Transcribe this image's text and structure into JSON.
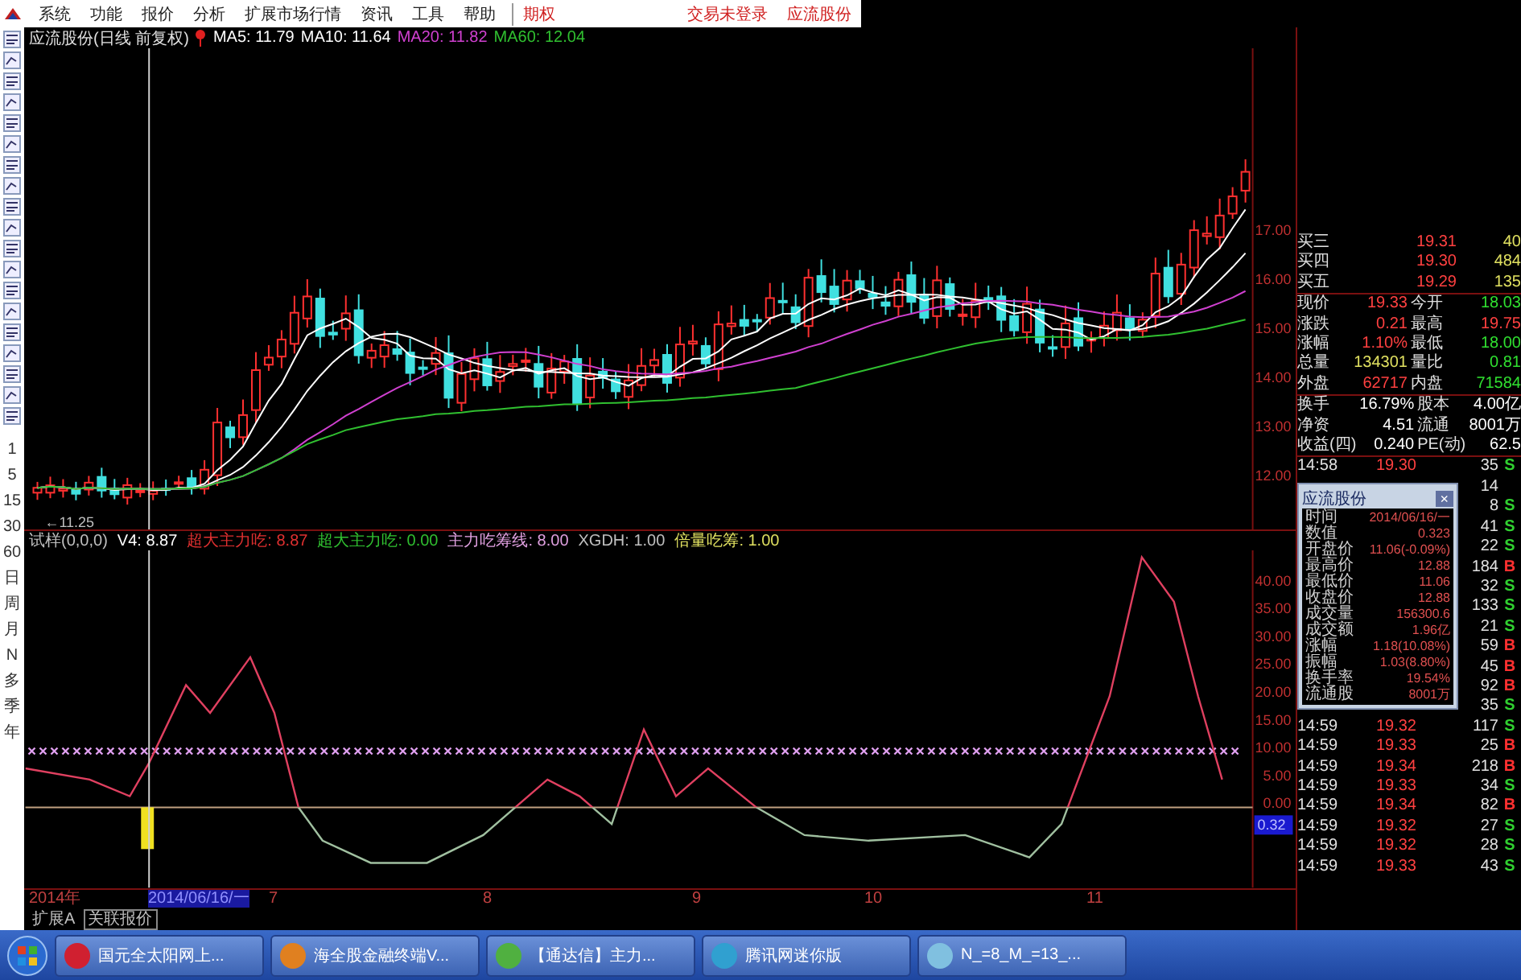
{
  "menu": {
    "items": [
      "系统",
      "功能",
      "报价",
      "分析",
      "扩展市场行情",
      "资讯",
      "工具",
      "帮助"
    ],
    "option": "期权",
    "status": "交易未登录",
    "stock": "应流股份"
  },
  "chart_header": {
    "title": "应流股份(日线 前复权)",
    "ma_values": [
      {
        "label": "MA5: 11.79",
        "color": "#ffffff"
      },
      {
        "label": "MA10: 11.64",
        "color": "#ffffff"
      },
      {
        "label": "MA20: 11.82",
        "color": "#d040d0"
      },
      {
        "label": "MA60: 12.04",
        "color": "#30c030"
      }
    ]
  },
  "price_axis": [
    "17.00",
    "16.00",
    "15.00",
    "14.00",
    "13.00",
    "12.00"
  ],
  "low_marker": "←11.25",
  "indicator_header": [
    {
      "label": "试样(0,0,0)",
      "color": "#c0c0c0"
    },
    {
      "label": "V4: 8.87",
      "color": "#ffffff"
    },
    {
      "label": "超大主力吃: 8.87",
      "color": "#e03030"
    },
    {
      "label": "超大主力吃: 0.00",
      "color": "#30c030"
    },
    {
      "label": "主力吃筹线: 8.00",
      "color": "#e0a0e0"
    },
    {
      "label": "XGDH: 1.00",
      "color": "#c0c0c0"
    },
    {
      "label": "倍量吃筹: 1.00",
      "color": "#e0e060"
    }
  ],
  "indicator_axis": [
    "40.00",
    "35.00",
    "30.00",
    "25.00",
    "20.00",
    "15.00",
    "10.00",
    "5.00",
    "0.00"
  ],
  "indicator_reading": "0.32",
  "toolbar_periods": [
    "1",
    "5",
    "15",
    "30",
    "60",
    "日",
    "周",
    "月",
    "N",
    "多",
    "季",
    "年"
  ],
  "dates": [
    {
      "label": "2014年",
      "selected": false
    },
    {
      "label": "2014/06/16/一",
      "selected": true
    },
    {
      "label": "7",
      "selected": false
    },
    {
      "label": "8",
      "selected": false
    },
    {
      "label": "9",
      "selected": false
    },
    {
      "label": "10",
      "selected": false
    },
    {
      "label": "11",
      "selected": false
    }
  ],
  "tabs": [
    {
      "label": "扩展A",
      "selected": false
    },
    {
      "label": "关联报价",
      "selected": true
    }
  ],
  "quotes": [
    [
      {
        "label": "买三",
        "value": "19.31",
        "color": "#ff4040",
        "extra": "40"
      },
      {
        "label": "买四",
        "value": "19.30",
        "color": "#ff4040",
        "extra": "484"
      },
      {
        "label": "买五",
        "value": "19.29",
        "color": "#ff4040",
        "extra": "135"
      }
    ],
    [
      {
        "label": "现价",
        "value": "19.33",
        "color": "#ff4040",
        "right": {
          "label": "今开",
          "value": "18.03",
          "color": "#30e030"
        }
      },
      {
        "label": "涨跌",
        "value": "0.21",
        "color": "#ff4040",
        "right": {
          "label": "最高",
          "value": "19.75",
          "color": "#ff4040"
        }
      },
      {
        "label": "涨幅",
        "value": "1.10%",
        "color": "#ff4040",
        "right": {
          "label": "最低",
          "value": "18.00",
          "color": "#30e030"
        }
      },
      {
        "label": "总量",
        "value": "134301",
        "color": "#e0e060",
        "right": {
          "label": "量比",
          "value": "0.81",
          "color": "#30e030"
        }
      },
      {
        "label": "外盘",
        "value": "62717",
        "color": "#ff4040",
        "right": {
          "label": "内盘",
          "value": "71584",
          "color": "#30e030"
        }
      }
    ],
    [
      {
        "label": "换手",
        "value": "16.79%",
        "color": "#ffffff",
        "right": {
          "label": "股本",
          "value": "4.00亿",
          "color": "#ffffff"
        }
      },
      {
        "label": "净资",
        "value": "4.51",
        "color": "#ffffff",
        "right": {
          "label": "流通",
          "value": "8001万",
          "color": "#ffffff"
        }
      },
      {
        "label": "收益(四)",
        "value": "0.240",
        "color": "#ffffff",
        "right": {
          "label": "PE(动)",
          "value": "62.5",
          "color": "#ffffff"
        }
      }
    ]
  ],
  "ticks": [
    {
      "time": "14:58",
      "price": "19.30",
      "volume": "35",
      "side": "S",
      "kind": "sell"
    },
    {
      "volume": "14"
    },
    {
      "volume": "8",
      "side": "S",
      "kind": "sell"
    },
    {
      "volume": "41",
      "side": "S",
      "kind": "sell"
    },
    {
      "volume": "22",
      "side": "S",
      "kind": "sell"
    },
    {
      "volume": "184",
      "side": "B",
      "kind": "buy"
    },
    {
      "volume": "32",
      "side": "S",
      "kind": "sell"
    },
    {
      "volume": "133",
      "side": "S",
      "kind": "sell"
    },
    {
      "volume": "21",
      "side": "S",
      "kind": "sell"
    },
    {
      "volume": "59",
      "side": "B",
      "kind": "buy"
    },
    {
      "volume": "45",
      "side": "B",
      "kind": "buy"
    },
    {
      "volume": "92",
      "side": "B",
      "kind": "buy"
    },
    {
      "volume": "35",
      "side": "S",
      "kind": "sell"
    },
    {
      "time": "14:59",
      "price": "19.32",
      "volume": "117",
      "side": "S",
      "kind": "sell"
    },
    {
      "time": "14:59",
      "price": "19.33",
      "volume": "25",
      "side": "B",
      "kind": "buy"
    },
    {
      "time": "14:59",
      "price": "19.34",
      "volume": "218",
      "side": "B",
      "kind": "buy"
    },
    {
      "time": "14:59",
      "price": "19.33",
      "volume": "34",
      "side": "S",
      "kind": "sell"
    },
    {
      "time": "14:59",
      "price": "19.34",
      "volume": "82",
      "side": "B",
      "kind": "buy"
    },
    {
      "time": "14:59",
      "price": "19.32",
      "volume": "27",
      "side": "S",
      "kind": "sell"
    },
    {
      "time": "14:59",
      "price": "19.32",
      "volume": "28",
      "side": "S",
      "kind": "sell"
    },
    {
      "time": "14:59",
      "price": "19.33",
      "volume": "43",
      "side": "S",
      "kind": "sell"
    }
  ],
  "popup": {
    "title": "应流股份",
    "close": "×",
    "rows": [
      {
        "label": "时间",
        "value": "2014/06/16/一"
      },
      {
        "label": "数值",
        "value": "0.323"
      },
      {
        "label": "开盘价",
        "value": "11.06(-0.09%)"
      },
      {
        "label": "最高价",
        "value": "12.88"
      },
      {
        "label": "最低价",
        "value": "11.06"
      },
      {
        "label": "收盘价",
        "value": "12.88"
      },
      {
        "label": "成交量",
        "value": "156300.6"
      },
      {
        "label": "成交额",
        "value": "1.96亿"
      },
      {
        "label": "涨幅",
        "value": "1.18(10.08%)"
      },
      {
        "label": "振幅",
        "value": "1.03(8.80%)"
      },
      {
        "label": "换手率",
        "value": "19.54%"
      },
      {
        "label": "流通股",
        "value": "8001万"
      }
    ]
  },
  "taskbar": [
    "国元全太阳网上...",
    "海全股金融终端V...",
    "【通达信】主力...",
    "腾讯网迷你版",
    "N_=8_M_=13_..."
  ]
}
